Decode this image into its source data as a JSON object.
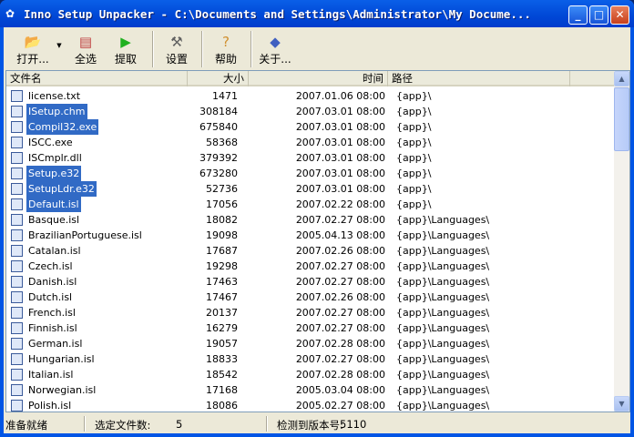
{
  "window": {
    "title": "Inno Setup Unpacker - C:\\Documents and Settings\\Administrator\\My Docume...",
    "minimize": "_",
    "maximize": "□",
    "close": "✕"
  },
  "toolbar": {
    "open": "打开...",
    "select_all": "全选",
    "extract": "提取",
    "settings": "设置",
    "help": "帮助",
    "about": "关于..."
  },
  "columns": {
    "name": "文件名",
    "size": "大小",
    "time": "时间",
    "path": "路径"
  },
  "files": [
    {
      "name": "license.txt",
      "size": "1471",
      "time": "2007.01.06 08:00",
      "path": "{app}\\",
      "selected": false
    },
    {
      "name": "ISetup.chm",
      "size": "308184",
      "time": "2007.03.01 08:00",
      "path": "{app}\\",
      "selected": true
    },
    {
      "name": "Compil32.exe",
      "size": "675840",
      "time": "2007.03.01 08:00",
      "path": "{app}\\",
      "selected": true
    },
    {
      "name": "ISCC.exe",
      "size": "58368",
      "time": "2007.03.01 08:00",
      "path": "{app}\\",
      "selected": false
    },
    {
      "name": "ISCmplr.dll",
      "size": "379392",
      "time": "2007.03.01 08:00",
      "path": "{app}\\",
      "selected": false
    },
    {
      "name": "Setup.e32",
      "size": "673280",
      "time": "2007.03.01 08:00",
      "path": "{app}\\",
      "selected": true
    },
    {
      "name": "SetupLdr.e32",
      "size": "52736",
      "time": "2007.03.01 08:00",
      "path": "{app}\\",
      "selected": true
    },
    {
      "name": "Default.isl",
      "size": "17056",
      "time": "2007.02.22 08:00",
      "path": "{app}\\",
      "selected": true
    },
    {
      "name": "Basque.isl",
      "size": "18082",
      "time": "2007.02.27 08:00",
      "path": "{app}\\Languages\\",
      "selected": false
    },
    {
      "name": "BrazilianPortuguese.isl",
      "size": "19098",
      "time": "2005.04.13 08:00",
      "path": "{app}\\Languages\\",
      "selected": false
    },
    {
      "name": "Catalan.isl",
      "size": "17687",
      "time": "2007.02.26 08:00",
      "path": "{app}\\Languages\\",
      "selected": false
    },
    {
      "name": "Czech.isl",
      "size": "19298",
      "time": "2007.02.27 08:00",
      "path": "{app}\\Languages\\",
      "selected": false
    },
    {
      "name": "Danish.isl",
      "size": "17463",
      "time": "2007.02.27 08:00",
      "path": "{app}\\Languages\\",
      "selected": false
    },
    {
      "name": "Dutch.isl",
      "size": "17467",
      "time": "2007.02.26 08:00",
      "path": "{app}\\Languages\\",
      "selected": false
    },
    {
      "name": "French.isl",
      "size": "20137",
      "time": "2007.02.27 08:00",
      "path": "{app}\\Languages\\",
      "selected": false
    },
    {
      "name": "Finnish.isl",
      "size": "16279",
      "time": "2007.02.27 08:00",
      "path": "{app}\\Languages\\",
      "selected": false
    },
    {
      "name": "German.isl",
      "size": "19057",
      "time": "2007.02.28 08:00",
      "path": "{app}\\Languages\\",
      "selected": false
    },
    {
      "name": "Hungarian.isl",
      "size": "18833",
      "time": "2007.02.27 08:00",
      "path": "{app}\\Languages\\",
      "selected": false
    },
    {
      "name": "Italian.isl",
      "size": "18542",
      "time": "2007.02.28 08:00",
      "path": "{app}\\Languages\\",
      "selected": false
    },
    {
      "name": "Norwegian.isl",
      "size": "17168",
      "time": "2005.03.04 08:00",
      "path": "{app}\\Languages\\",
      "selected": false
    },
    {
      "name": "Polish.isl",
      "size": "18086",
      "time": "2005.02.27 08:00",
      "path": "{app}\\Languages\\",
      "selected": false
    }
  ],
  "status": {
    "ready": "准备就绪",
    "selected_label": "选定文件数:",
    "selected_count": "5",
    "version_label": "检测到版本号:",
    "version": "5110"
  }
}
